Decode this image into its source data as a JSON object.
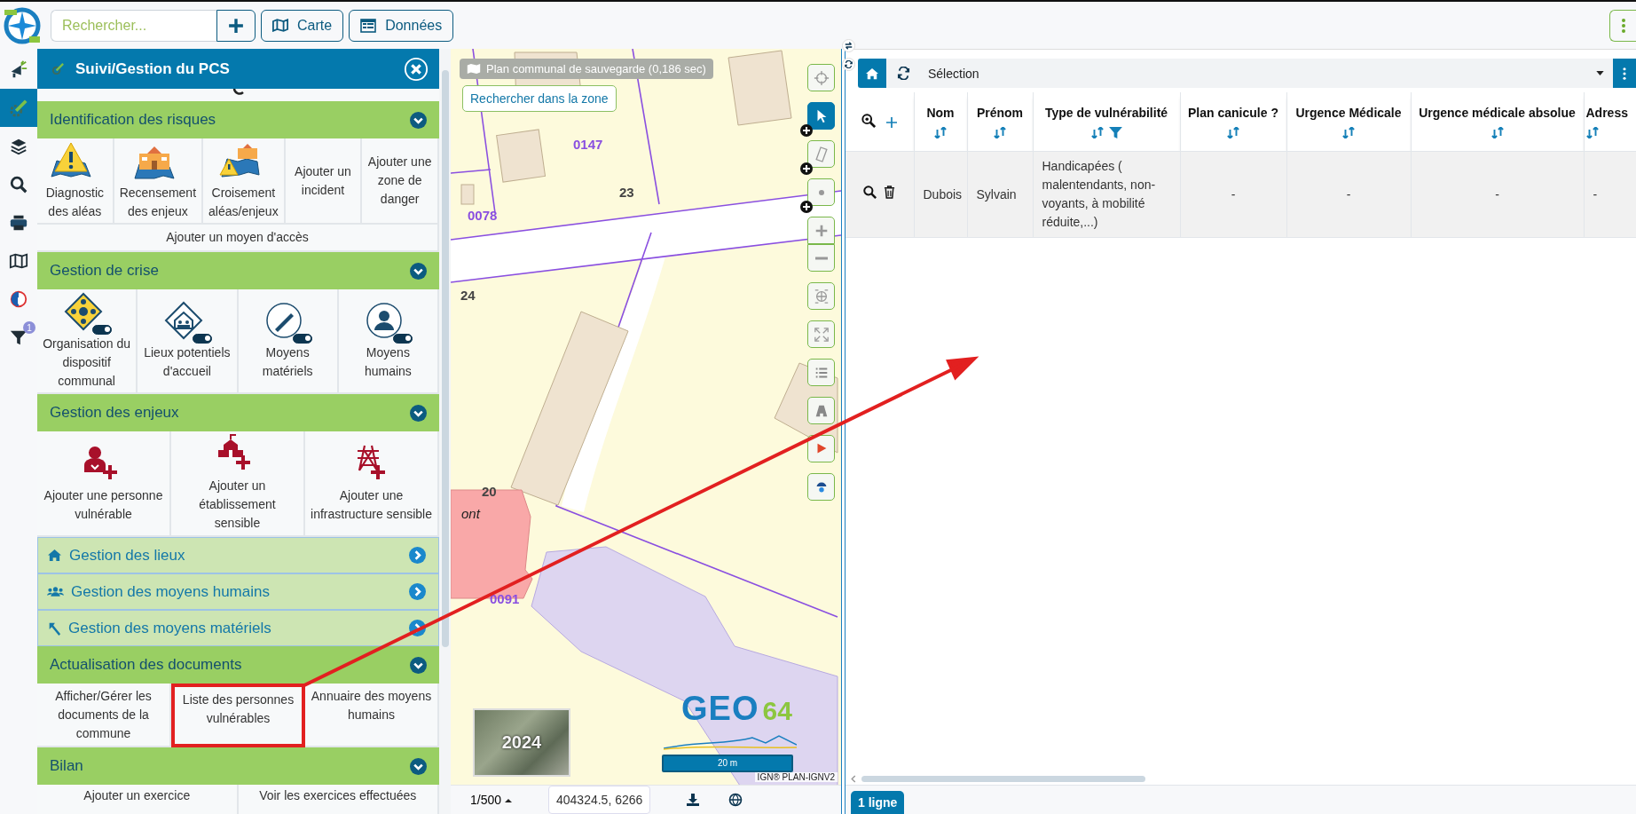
{
  "search": {
    "placeholder": "Rechercher..."
  },
  "top_buttons": [
    {
      "label": "Carte"
    },
    {
      "label": "Données"
    }
  ],
  "rail_items": [
    {
      "selected": false
    },
    {
      "selected": true
    },
    {
      "selected": false
    },
    {
      "selected": false
    },
    {
      "selected": false
    },
    {
      "selected": false
    },
    {
      "selected": false
    },
    {
      "selected": false,
      "badge": "1"
    }
  ],
  "panel": {
    "title": "Suivi/Gestion du PCS",
    "sections": [
      {
        "title": "Identification des risques",
        "expanded": true,
        "tiles": [
          {
            "label": "Diagnostic des aléas",
            "highlighted": false
          },
          {
            "label": "Recensement des enjeux",
            "highlighted": false
          },
          {
            "label": "Croisement aléas/enjeux",
            "highlighted": false
          },
          {
            "label": "Ajouter un incident",
            "highlighted": false
          },
          {
            "label": "Ajouter une zone de danger",
            "highlighted": false
          }
        ],
        "wide_tile": {
          "label": "Ajouter un moyen d'accès",
          "highlighted": false
        }
      },
      {
        "title": "Gestion de crise",
        "expanded": true,
        "tiles": [
          {
            "label": "Organisation du dispositif communal",
            "highlighted": false,
            "on": true
          },
          {
            "label": "Lieux potentiels d'accueil",
            "highlighted": false,
            "on": true
          },
          {
            "label": "Moyens matériels",
            "highlighted": false,
            "on": true
          },
          {
            "label": "Moyens humains",
            "highlighted": false,
            "on": true
          }
        ]
      },
      {
        "title": "Gestion des enjeux",
        "expanded": true,
        "tiles": [
          {
            "label": "Ajouter une personne vulnérable",
            "highlighted": false
          },
          {
            "label": "Ajouter un établissement sensible",
            "highlighted": false
          },
          {
            "label": "Ajouter une infrastructure sensible",
            "highlighted": false
          }
        ]
      },
      {
        "title": "Gestion des lieux",
        "expanded": false
      },
      {
        "title": "Gestion des moyens humains",
        "expanded": false
      },
      {
        "title": "Gestion des moyens matériels",
        "expanded": false
      },
      {
        "title": "Actualisation des documents",
        "expanded": true,
        "tiles": [
          {
            "label": "Afficher/Gérer les documents de la commune",
            "highlighted": false
          },
          {
            "label": "Liste des personnes vulnérables",
            "highlighted": true
          },
          {
            "label": "Annuaire des moyens humains",
            "highlighted": false
          }
        ]
      },
      {
        "title": "Bilan",
        "expanded": true,
        "tiles": [
          {
            "label": "Ajouter un exercice",
            "highlighted": false
          },
          {
            "label": "Voir les exercices effectuées",
            "highlighted": false
          }
        ]
      }
    ]
  },
  "map": {
    "layer_info": "Plan communal de sauvegarde (0,186 sec)",
    "search_zone_button": "Rechercher dans la zone",
    "labels": [
      "0147",
      "23",
      "0078",
      "24",
      "20",
      "ont",
      "0091"
    ],
    "tools": [
      {
        "selected": false
      },
      {
        "selected": true
      },
      {
        "selected": false
      },
      {
        "selected": false
      },
      {
        "selected": false
      },
      {
        "selected": false
      },
      {
        "selected": false
      },
      {
        "selected": false
      },
      {
        "selected": false
      },
      {
        "selected": false
      },
      {
        "selected": false
      },
      {
        "selected": false
      }
    ],
    "thumbnail_label": "2024",
    "logo_text": "GEO",
    "logo_number": "64",
    "scale": "20 m",
    "attribution": "IGN® PLAN-IGNV2",
    "scale_ratio": "1/500",
    "coordinates": "404324.5, 6266"
  },
  "table": {
    "selection": "Sélection",
    "columns": [
      {
        "label": "Nom",
        "filter": false
      },
      {
        "label": "Prénom",
        "filter": false
      },
      {
        "label": "Type de vulnérabilité",
        "filter": true
      },
      {
        "label": "Plan canicule ?",
        "filter": false
      },
      {
        "label": "Urgence Médicale",
        "filter": false
      },
      {
        "label": "Urgence médicale absolue",
        "filter": false
      },
      {
        "label": "Adress",
        "filter": false
      }
    ],
    "rows": [
      {
        "cells": [
          "Dubois",
          "Sylvain",
          "Handicapées ( malentendants, non-voyants, à mobilité réduite,...)",
          "-",
          "-",
          "-",
          "-"
        ]
      }
    ],
    "count": "1 ligne"
  },
  "annotation_arrow": true
}
